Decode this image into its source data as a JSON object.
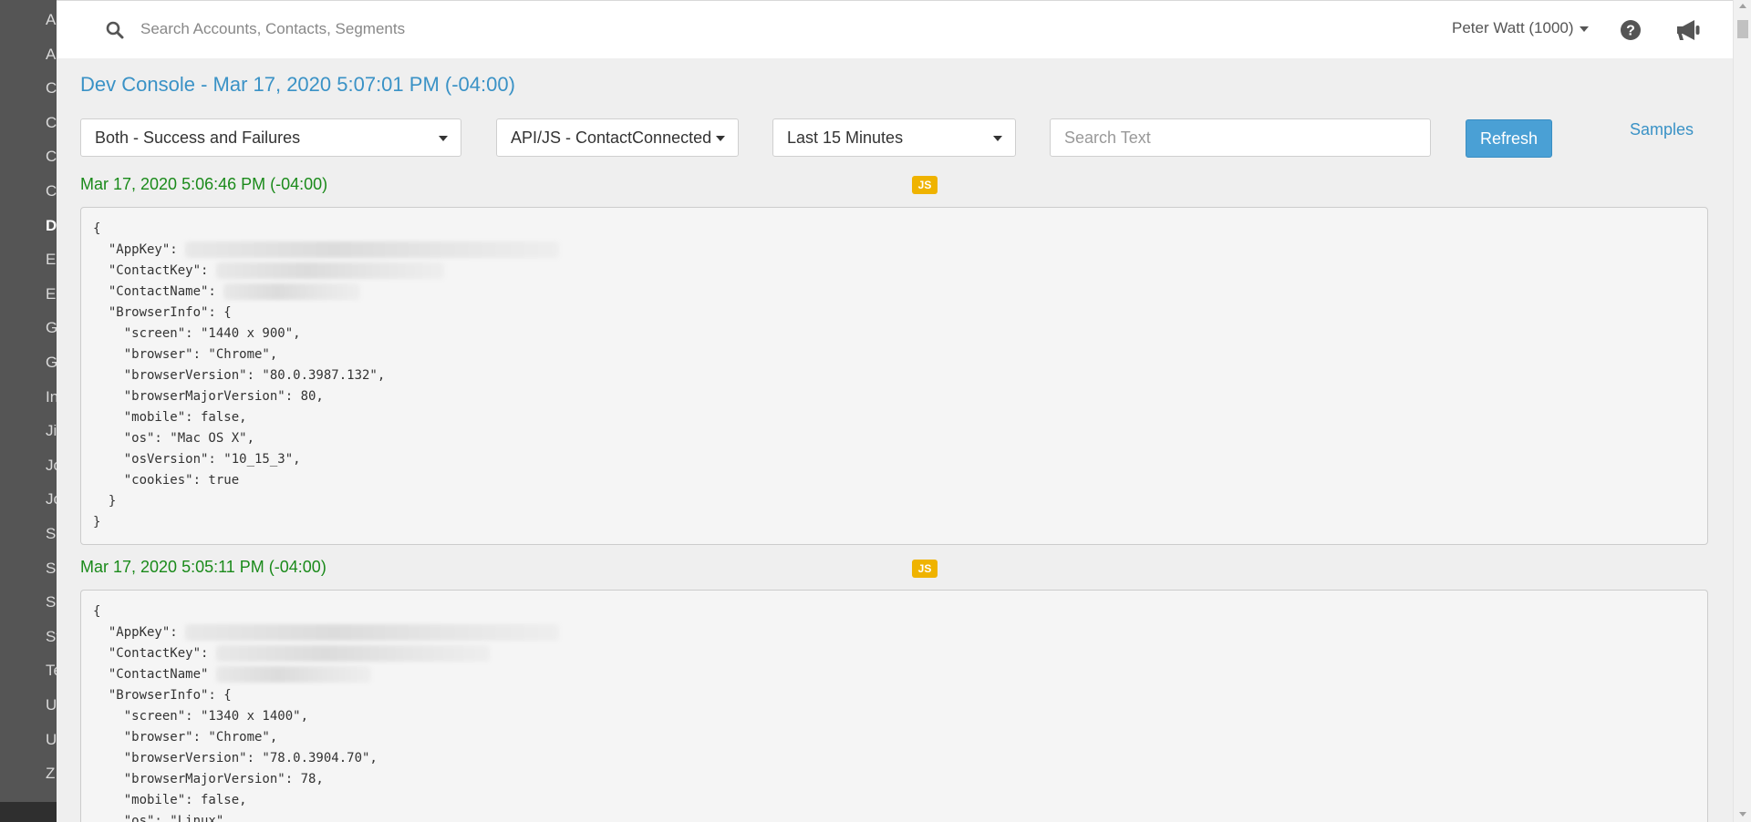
{
  "sidebar": {
    "items": [
      {
        "label": "A",
        "active": false
      },
      {
        "label": "A",
        "active": false
      },
      {
        "label": "C",
        "active": false
      },
      {
        "label": "C",
        "active": false
      },
      {
        "label": "C",
        "active": false
      },
      {
        "label": "C",
        "active": false
      },
      {
        "label": "D",
        "active": true
      },
      {
        "label": "E",
        "active": false
      },
      {
        "label": "E",
        "active": false
      },
      {
        "label": "G",
        "active": false
      },
      {
        "label": "G",
        "active": false
      },
      {
        "label": "In",
        "active": false
      },
      {
        "label": "Ji",
        "active": false
      },
      {
        "label": "Jo",
        "active": false
      },
      {
        "label": "Jo",
        "active": false
      },
      {
        "label": "Sa",
        "active": false
      },
      {
        "label": "Sa",
        "active": false
      },
      {
        "label": "Sl",
        "active": false
      },
      {
        "label": "Sy",
        "active": false
      },
      {
        "label": "Te",
        "active": false
      },
      {
        "label": "U",
        "active": false
      },
      {
        "label": "U",
        "active": false
      },
      {
        "label": "Z",
        "active": false
      }
    ]
  },
  "header": {
    "search_placeholder": "Search Accounts, Contacts, Segments",
    "user_label": "Peter Watt (1000)",
    "icons": [
      "search-icon",
      "help-icon",
      "bullhorn-icon"
    ]
  },
  "page": {
    "title": "Dev Console - Mar 17, 2020 5:07:01 PM (-04:00)"
  },
  "filters": {
    "status_value": "Both - Success and Failures",
    "type_value": "API/JS - ContactConnected",
    "time_value": "Last 15 Minutes",
    "search_placeholder": "Search Text",
    "refresh_label": "Refresh",
    "samples_label": "Samples"
  },
  "colors": {
    "accent": "#3a92c6",
    "button": "#4aa0d5",
    "timestamp": "#1a8a1a",
    "badge": "#efb300",
    "sidebar": "#555555"
  },
  "entries": [
    {
      "timestamp": "Mar 17, 2020 5:06:46 PM (-04:00)",
      "badge": "JS",
      "lines": [
        {
          "text": "{"
        },
        {
          "text": "  \"AppKey\": ",
          "redact": 410
        },
        {
          "text": "  \"ContactKey\": ",
          "redact": 250
        },
        {
          "text": "  \"ContactName\": ",
          "redact": 150
        },
        {
          "text": "  \"BrowserInfo\": {"
        },
        {
          "text": "    \"screen\": \"1440 x 900\","
        },
        {
          "text": "    \"browser\": \"Chrome\","
        },
        {
          "text": "    \"browserVersion\": \"80.0.3987.132\","
        },
        {
          "text": "    \"browserMajorVersion\": 80,"
        },
        {
          "text": "    \"mobile\": false,"
        },
        {
          "text": "    \"os\": \"Mac OS X\","
        },
        {
          "text": "    \"osVersion\": \"10_15_3\","
        },
        {
          "text": "    \"cookies\": true"
        },
        {
          "text": "  }"
        },
        {
          "text": "}"
        }
      ]
    },
    {
      "timestamp": "Mar 17, 2020 5:05:11 PM (-04:00)",
      "badge": "JS",
      "lines": [
        {
          "text": "{"
        },
        {
          "text": "  \"AppKey\": ",
          "redact": 410
        },
        {
          "text": "  \"ContactKey\": ",
          "redact": 300
        },
        {
          "text": "  \"ContactName\" ",
          "redact": 170
        },
        {
          "text": "  \"BrowserInfo\": {"
        },
        {
          "text": "    \"screen\": \"1340 x 1400\","
        },
        {
          "text": "    \"browser\": \"Chrome\","
        },
        {
          "text": "    \"browserVersion\": \"78.0.3904.70\","
        },
        {
          "text": "    \"browserMajorVersion\": 78,"
        },
        {
          "text": "    \"mobile\": false,"
        },
        {
          "text": "    \"os\": \"Linux\","
        }
      ]
    }
  ]
}
